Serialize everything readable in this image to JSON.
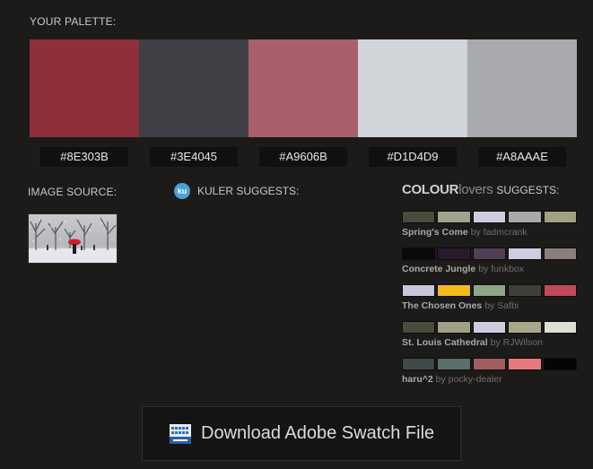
{
  "palette": {
    "title": "YOUR PALETTE:",
    "swatches": [
      {
        "hex": "#8E303B",
        "color": "#8E303B"
      },
      {
        "hex": "#3E4045",
        "color": "#3E4045"
      },
      {
        "hex": "#A9606B",
        "color": "#A9606B"
      },
      {
        "hex": "#D1D4D9",
        "color": "#D1D4D9"
      },
      {
        "hex": "#A8AAAE",
        "color": "#A8AAAE"
      }
    ]
  },
  "image_source": {
    "label": "IMAGE SOURCE:"
  },
  "kuler": {
    "logo": "ku",
    "label": "KULER SUGGESTS:"
  },
  "colourlovers": {
    "brand_bold": "COLOUR",
    "brand_light": "lovers",
    "suggests": "SUGGESTS:",
    "palettes": [
      {
        "name": "Spring's Come",
        "by": "by",
        "author": "fadmcrank",
        "colors": [
          "#4B4B3B",
          "#A1A28E",
          "#CECDE0",
          "#A9AAA8",
          "#A2A080"
        ]
      },
      {
        "name": "Concrete Jungle",
        "by": "by",
        "author": "funkbox",
        "colors": [
          "#0A080B",
          "#281A2B",
          "#523F55",
          "#CECDE0",
          "#8A7E7E"
        ]
      },
      {
        "name": "The Chosen Ones",
        "by": "by",
        "author": "Safbi",
        "colors": [
          "#C8C6D8",
          "#F4B91A",
          "#8FA684",
          "#3E3F3B",
          "#C24A58"
        ]
      },
      {
        "name": "St. Louis Cathedral",
        "by": "by",
        "author": "RJWilson",
        "colors": [
          "#4B4C3B",
          "#9FA086",
          "#CDCCDF",
          "#A7A889",
          "#DCDFD1"
        ]
      },
      {
        "name": "haru^2",
        "by": "by",
        "author": "pocky-dealer",
        "colors": [
          "#3E4A4A",
          "#5A6F6C",
          "#A15E61",
          "#E7787E",
          "#050505"
        ]
      }
    ]
  },
  "download": {
    "label": "Download Adobe Swatch File",
    "icon": "swatch-file-icon"
  }
}
